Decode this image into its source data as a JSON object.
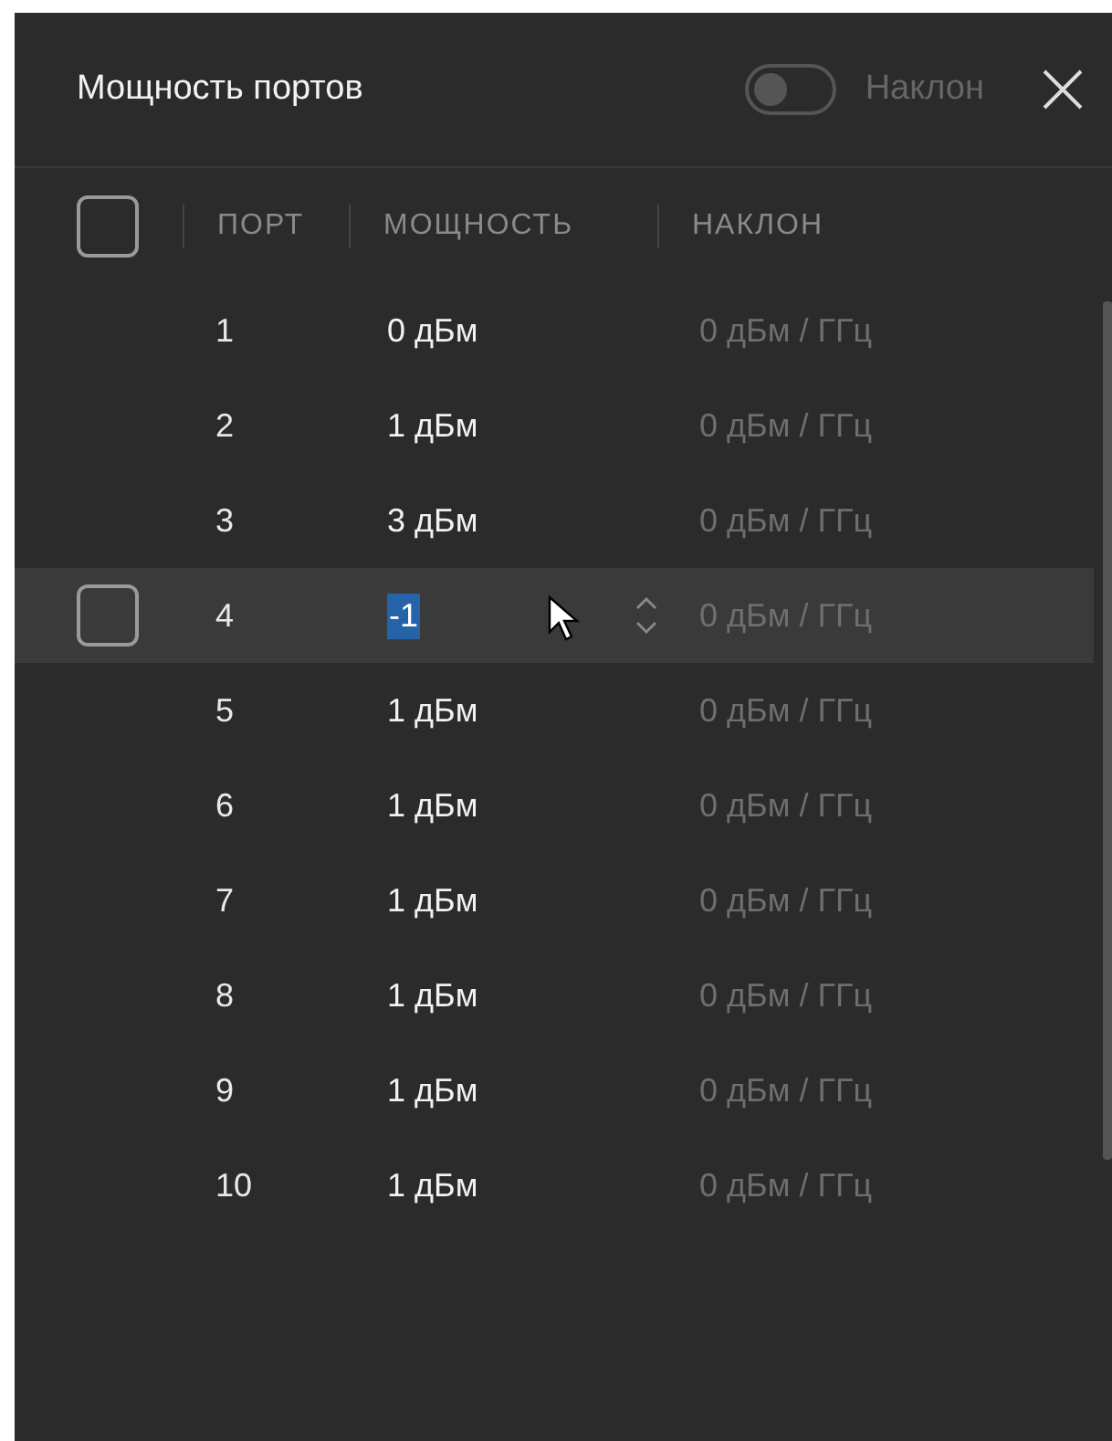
{
  "panel": {
    "title": "Мощность портов",
    "toggle": {
      "label": "Наклон",
      "on": false
    }
  },
  "table": {
    "select_all": {
      "checked": false
    },
    "columns": [
      "ПОРТ",
      "МОЩНОСТЬ",
      "НАКЛОН"
    ],
    "rows": [
      {
        "kind": "plain",
        "port": "1",
        "power": "0 дБм",
        "slope": "0 дБм / ГГц"
      },
      {
        "kind": "plain",
        "port": "2",
        "power": "1 дБм",
        "slope": "0 дБм / ГГц"
      },
      {
        "kind": "plain",
        "port": "3",
        "power": "3 дБм",
        "slope": "0 дБм / ГГц"
      },
      {
        "kind": "editing",
        "checked": false,
        "port": "4",
        "power": "-1",
        "slope": "0 дБм / ГГц"
      },
      {
        "kind": "plain",
        "port": "5",
        "power": "1 дБм",
        "slope": "0 дБм / ГГц"
      },
      {
        "kind": "plain",
        "port": "6",
        "power": "1 дБм",
        "slope": "0 дБм / ГГц"
      },
      {
        "kind": "plain",
        "port": "7",
        "power": "1 дБм",
        "slope": "0 дБм / ГГц"
      },
      {
        "kind": "plain",
        "port": "8",
        "power": "1 дБм",
        "slope": "0 дБм / ГГц"
      },
      {
        "kind": "plain",
        "port": "9",
        "power": "1 дБм",
        "slope": "0 дБм / ГГц"
      },
      {
        "kind": "plain",
        "port": "10",
        "power": "1 дБм",
        "slope": "0 дБм / ГГц"
      }
    ]
  }
}
